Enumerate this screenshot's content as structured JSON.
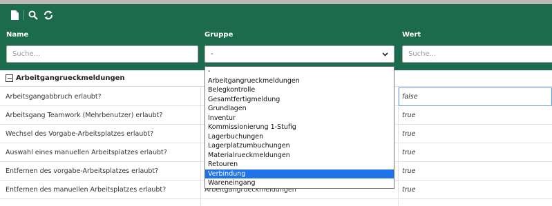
{
  "toolbar": {
    "icons": [
      "new-document-icon",
      "search-icon",
      "refresh-icon"
    ]
  },
  "columns": {
    "name": "Name",
    "gruppe": "Gruppe",
    "wert": "Wert"
  },
  "filters": {
    "name_placeholder": "Suche...",
    "gruppe_selected": "-",
    "wert_placeholder": "Suche..."
  },
  "group": {
    "title": "Arbeitgangrueckmeldungen"
  },
  "rows": [
    {
      "name": "Arbeitsgangabbruch erlaubt?",
      "gruppe": "",
      "wert": "false"
    },
    {
      "name": "Arbeitsgang Teamwork (Mehrbenutzer) erlaubt?",
      "gruppe": "",
      "wert": "true"
    },
    {
      "name": "Wechsel des Vorgabe-Arbeitsplatzes erlaubt?",
      "gruppe": "",
      "wert": "true"
    },
    {
      "name": "Auswahl eines manuellen Arbeitsplatzes erlaubt?",
      "gruppe": "",
      "wert": "true"
    },
    {
      "name": "Entfernen des vorgabe-Arbeitsplatzes erlaubt?",
      "gruppe": "",
      "wert": "true"
    },
    {
      "name": "Entfernen des manuellen Arbeitsplatzes erlaubt?",
      "gruppe": "Arbeitgangrueckmeldungen",
      "wert": "true"
    }
  ],
  "dropdown": {
    "options": [
      "-",
      "Arbeitgangrueckmeldungen",
      "Belegkontrolle",
      "Gesamtfertigmeldung",
      "Grundlagen",
      "Inventur",
      "Kommissionierung 1-Stufig",
      "Lagerbuchungen",
      "Lagerplatzumbuchungen",
      "Materialrueckmeldungen",
      "Retouren",
      "Verbindung",
      "Wareneingang"
    ],
    "highlighted": "Verbindung"
  },
  "colors": {
    "header": "#1c6b4d",
    "selection": "#1e73e8"
  }
}
